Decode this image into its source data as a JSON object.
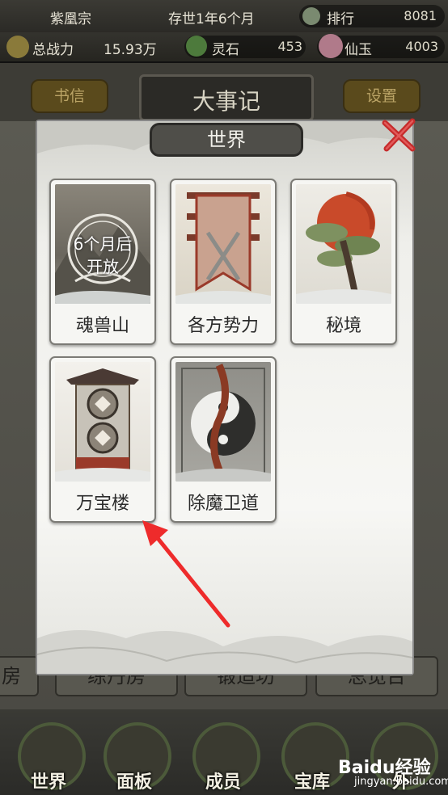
{
  "header": {
    "sect_name": "紫凰宗",
    "world_time": "存世1年6个月",
    "ranking_label": "排行",
    "ranking_value": "8081",
    "power_label": "总战力",
    "power_value": "15.93万",
    "spirit_stone_label": "灵石",
    "spirit_stone_value": "453",
    "jade_label": "仙玉",
    "jade_value": "4003"
  },
  "background": {
    "title": "大事记",
    "left_button": "书信",
    "right_button": "设置",
    "rooms": [
      "练丹房",
      "锻造坊",
      "总览台"
    ],
    "left_room_fragment": "房"
  },
  "modal": {
    "title": "世界",
    "cards": [
      {
        "label": "魂兽山",
        "locked": true,
        "lock_text_1": "6个月后",
        "lock_text_2": "开放"
      },
      {
        "label": "各方势力",
        "locked": false
      },
      {
        "label": "秘境",
        "locked": false
      },
      {
        "label": "万宝楼",
        "locked": false
      },
      {
        "label": "除魔卫道",
        "locked": false
      }
    ]
  },
  "nav": {
    "items": [
      "世界",
      "面板",
      "成员",
      "宝库",
      "外"
    ]
  },
  "watermark": {
    "brand": "Baidu经验",
    "url": "jingyan.baidu.com"
  },
  "colors": {
    "annotation_arrow": "#ee2b2b",
    "close_button": "#c62b2b"
  }
}
